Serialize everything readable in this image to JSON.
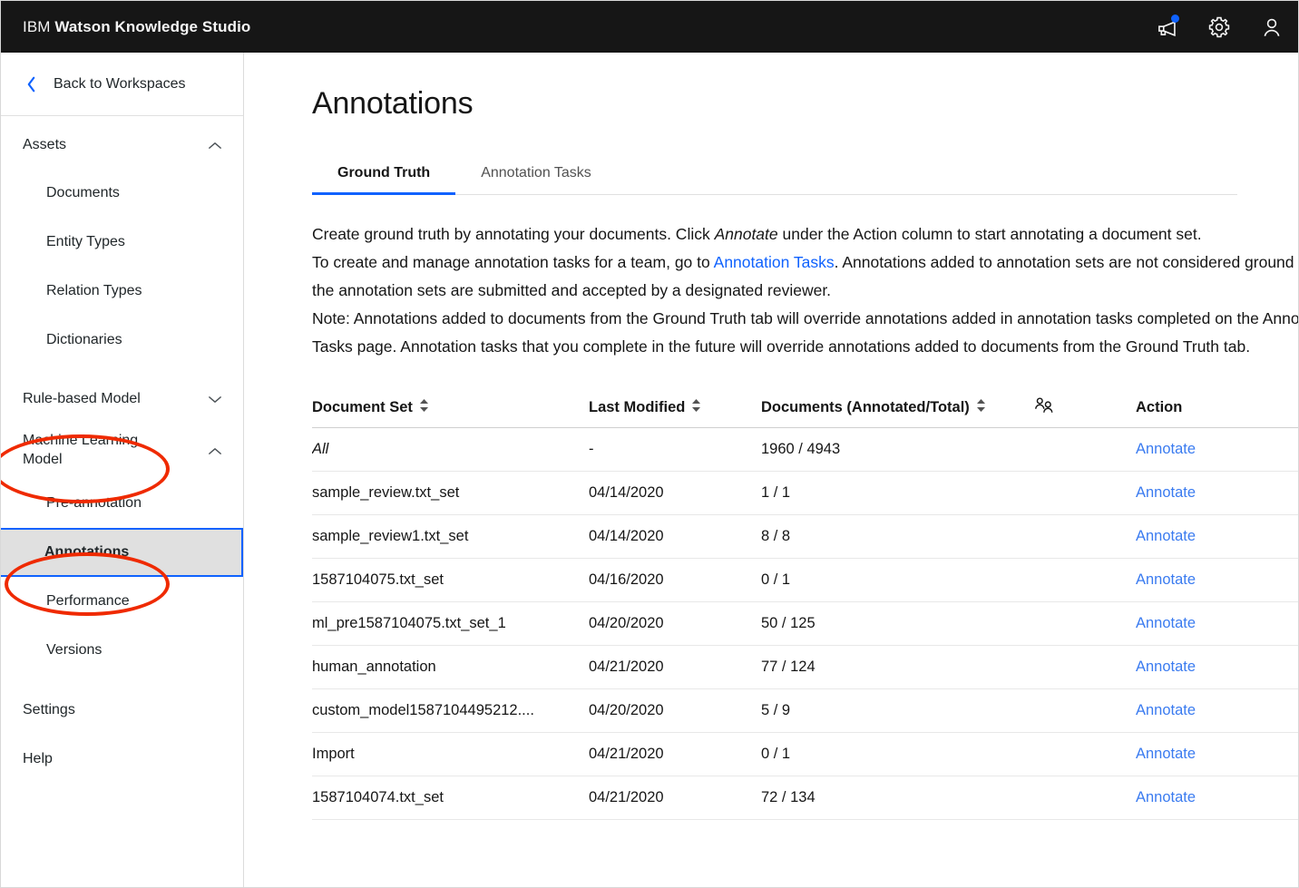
{
  "header": {
    "brand_prefix": "IBM",
    "brand_name": "Watson Knowledge Studio",
    "icons": {
      "announcements": "megaphone-icon",
      "settings": "gear-icon",
      "account": "user-avatar-icon"
    }
  },
  "sidebar": {
    "back_label": "Back to Workspaces",
    "back_icon": "chevron-left-icon",
    "sections": [
      {
        "label": "Assets",
        "expanded": true,
        "chevron": "chevron-up-icon",
        "items": [
          {
            "label": "Documents"
          },
          {
            "label": "Entity Types"
          },
          {
            "label": "Relation Types"
          },
          {
            "label": "Dictionaries"
          }
        ]
      },
      {
        "label": "Rule-based Model",
        "expanded": false,
        "chevron": "chevron-down-icon",
        "items": []
      },
      {
        "label": "Machine Learning Model",
        "expanded": true,
        "chevron": "chevron-up-icon",
        "items": [
          {
            "label": "Pre-annotation"
          },
          {
            "label": "Annotations",
            "selected": true
          },
          {
            "label": "Performance"
          },
          {
            "label": "Versions"
          }
        ]
      }
    ],
    "flat_items": [
      {
        "label": "Settings"
      },
      {
        "label": "Help"
      }
    ]
  },
  "main": {
    "page_title": "Annotations",
    "tabs": [
      {
        "label": "Ground Truth",
        "active": true
      },
      {
        "label": "Annotation Tasks",
        "active": false
      }
    ],
    "description": {
      "p1_a": "Create ground truth by annotating your documents. Click ",
      "p1_em": "Annotate",
      "p1_b": " under the Action column to start annotating a document set.",
      "p2_a": "To create and manage annotation tasks for a team, go to ",
      "p2_link": "Annotation Tasks",
      "p2_b": ". Annotations added to annotation sets are not considered ground truth until the annotation sets are submitted and accepted by a designated reviewer.",
      "p3": "Note: Annotations added to documents from the Ground Truth tab will override annotations added in annotation tasks completed on the Annotation Tasks page. Annotation tasks that you complete in the future will override annotations added to documents from the Ground Truth tab."
    },
    "table": {
      "headers": {
        "document_set": "Document Set",
        "last_modified": "Last Modified",
        "documents": "Documents (Annotated/Total)",
        "users_icon": "users-group-icon",
        "action": "Action"
      },
      "sort_icon": "sort-arrows-icon",
      "action_label": "Annotate",
      "rows": [
        {
          "name": "All",
          "italic": true,
          "modified": "-",
          "documents": "1960 / 4943",
          "users": "",
          "action": "Annotate"
        },
        {
          "name": "sample_review.txt_set",
          "italic": false,
          "modified": "04/14/2020",
          "documents": "1 / 1",
          "users": "",
          "action": "Annotate"
        },
        {
          "name": "sample_review1.txt_set",
          "italic": false,
          "modified": "04/14/2020",
          "documents": "8 / 8",
          "users": "",
          "action": "Annotate"
        },
        {
          "name": "1587104075.txt_set",
          "italic": false,
          "modified": "04/16/2020",
          "documents": "0 / 1",
          "users": "",
          "action": "Annotate"
        },
        {
          "name": "ml_pre1587104075.txt_set_1",
          "italic": false,
          "modified": "04/20/2020",
          "documents": "50 / 125",
          "users": "",
          "action": "Annotate"
        },
        {
          "name": "human_annotation",
          "italic": false,
          "modified": "04/21/2020",
          "documents": "77 / 124",
          "users": "",
          "action": "Annotate"
        },
        {
          "name": "custom_model1587104495212....",
          "italic": false,
          "modified": "04/20/2020",
          "documents": "5 / 9",
          "users": "",
          "action": "Annotate"
        },
        {
          "name": "Import",
          "italic": false,
          "modified": "04/21/2020",
          "documents": "0 / 1",
          "users": "",
          "action": "Annotate"
        },
        {
          "name": "1587104074.txt_set",
          "italic": false,
          "modified": "04/21/2020",
          "documents": "72 / 134",
          "users": "",
          "action": "Annotate"
        }
      ]
    }
  },
  "annotations_overlay": {
    "color": "#ef2a00",
    "shapes": [
      {
        "name": "highlight-machine-learning-model",
        "target": "Machine Learning Model"
      },
      {
        "name": "highlight-annotations-nav-item",
        "target": "Annotations"
      }
    ]
  },
  "colors": {
    "header_bg": "#161616",
    "accent_blue": "#0f62fe",
    "link_blue": "#3a7bf0",
    "selected_bg": "#e0e0e0",
    "annotation_red": "#ef2a00"
  }
}
